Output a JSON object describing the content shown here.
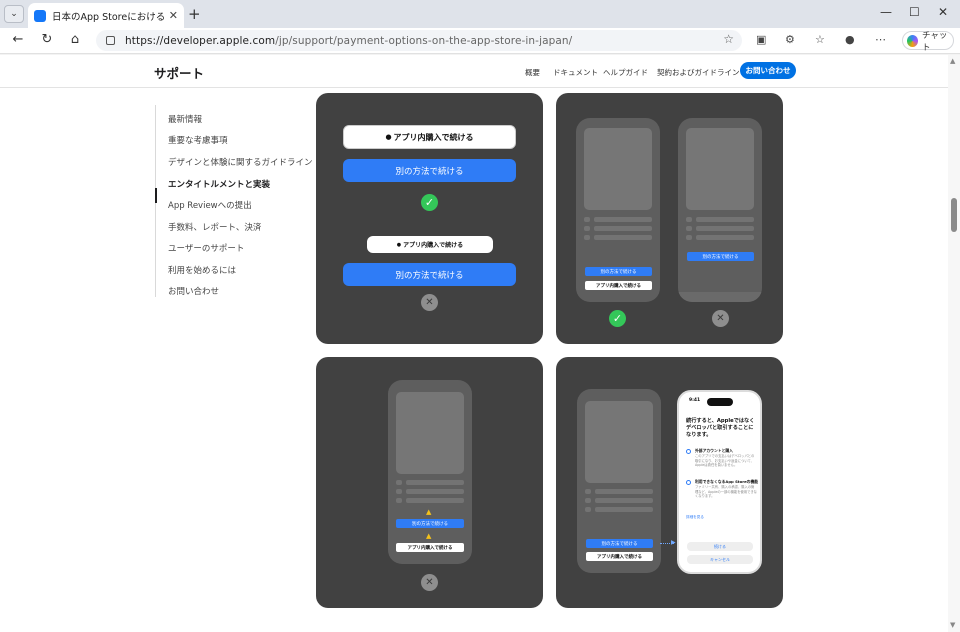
{
  "browser": {
    "tab_title": "日本のApp Storeにおける決済オプショ",
    "url_host": "https://developer.apple.com",
    "url_path": "/jp/support/payment-options-on-the-app-store-in-japan/",
    "copilot_label": "チャット"
  },
  "subnav": {
    "brand": "サポート",
    "links": [
      "概要",
      "ドキュメント",
      "ヘルプガイド",
      "契約およびガイドライン"
    ],
    "contact_button": "お問い合わせ"
  },
  "sidebar": {
    "items": [
      {
        "label": "最新情報"
      },
      {
        "label": "重要な考慮事項"
      },
      {
        "label": "デザインと体験に関するガイドライン"
      },
      {
        "label": "エンタイトルメントと実装",
        "active": true
      },
      {
        "label": "App Reviewへの提出"
      },
      {
        "label": "手数料、レポート、決済"
      },
      {
        "label": "ユーザーのサポート"
      },
      {
        "label": "利用を始めるには"
      },
      {
        "label": "お問い合わせ"
      }
    ]
  },
  "panel1": {
    "iap_label": "アプリ内購入で続ける",
    "alt_label": "別の方法で続ける"
  },
  "panel2": {
    "alt_label": "別の方法で続ける",
    "iap_label": "アプリ内購入で続ける"
  },
  "panel3": {
    "alt_label": "別の方法で続ける",
    "iap_label": "アプリ内購入で続ける"
  },
  "panel4": {
    "alt_label": "別の方法で続ける",
    "iap_label": "アプリ内購入で続ける",
    "sheet": {
      "time": "9:41",
      "title": "続行すると、Appleではなくデベロッパと取引することになります。",
      "item1_title": "外部アカウントと購入",
      "item1_body": "このアプリでの支払いはデベロッパとの取引になり、お支払いや返金について、Appleは責任を負いません。",
      "item2_title": "利用できなくなるApp Storeの機能",
      "item2_body": "ファミリー共有、購入の承認、購入の管理など、Appleの一部の機能を使用できなくなります。",
      "link": "詳細を見る",
      "continue": "続ける",
      "cancel": "キャンセル"
    }
  }
}
